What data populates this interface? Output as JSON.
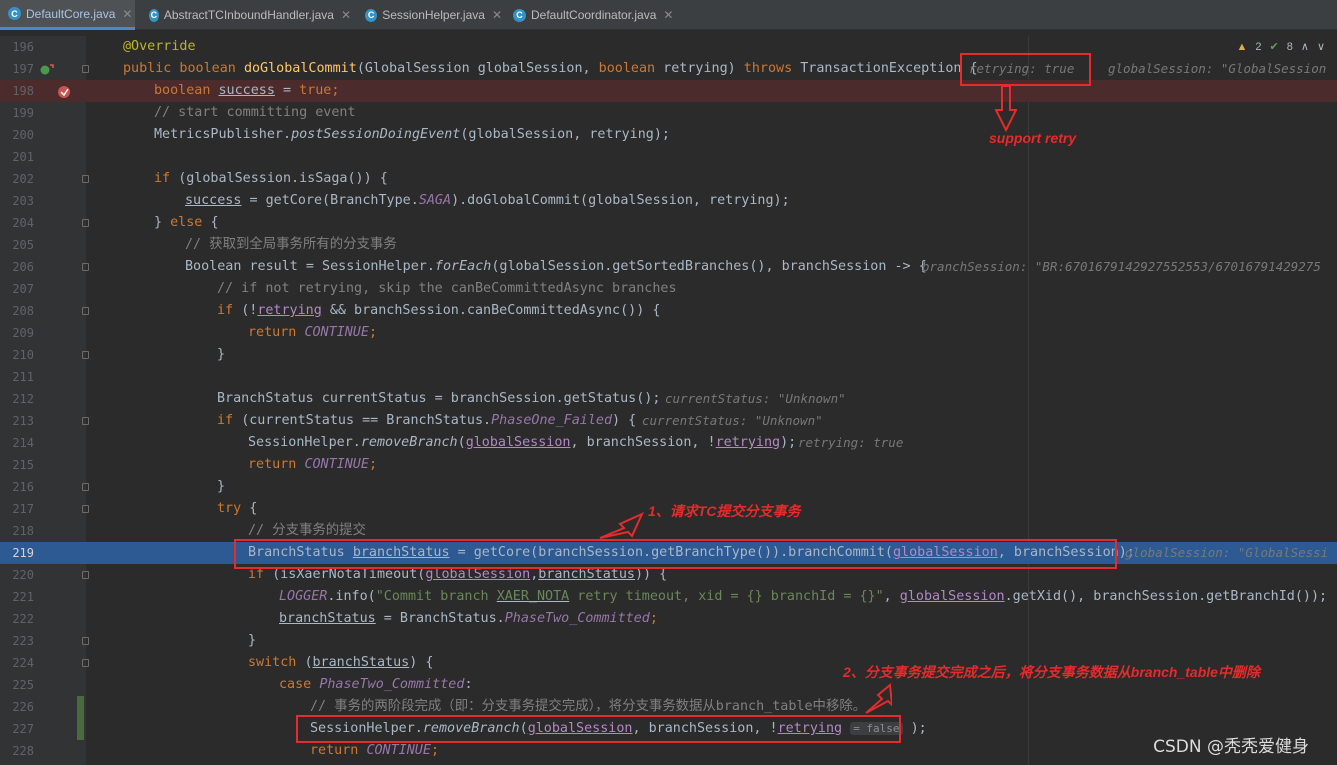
{
  "tabs": [
    {
      "label": "DefaultCore.java",
      "active": true
    },
    {
      "label": "AbstractTCInboundHandler.java",
      "active": false
    },
    {
      "label": "SessionHelper.java",
      "active": false
    },
    {
      "label": "DefaultCoordinator.java",
      "active": false
    }
  ],
  "tab_icon": "java-class-icon",
  "inspection": {
    "warnings": "2",
    "weak_warnings": "8",
    "up": "∧",
    "down": "∨"
  },
  "lines": [
    "196",
    "197",
    "198",
    "199",
    "200",
    "201",
    "202",
    "203",
    "204",
    "205",
    "206",
    "207",
    "208",
    "209",
    "210",
    "211",
    "212",
    "213",
    "214",
    "215",
    "216",
    "217",
    "218",
    "219",
    "220",
    "221",
    "222",
    "223",
    "224",
    "225",
    "226",
    "227",
    "228"
  ],
  "code": {
    "l196": "@Override",
    "l197_kw": "public boolean ",
    "l197_fn": "doGlobalCommit",
    "l197_a": "(GlobalSession globalSession, ",
    "l197_kw2": "boolean ",
    "l197_b": "retrying) ",
    "l197_kw3": "throws ",
    "l197_c": "TransactionException {",
    "l197_hint1": "retrying: true",
    "l197_hint2": "globalSession: \"GlobalSession",
    "l198_kw": "boolean ",
    "l198_var": "success",
    "l198_rest": " = ",
    "l198_kw2": "true",
    "l198_end": ";",
    "l199": "// start committing event",
    "l200_a": "MetricsPublisher.",
    "l200_fn": "postSessionDoingEvent",
    "l200_b": "(globalSession, retrying);",
    "l202_kw": "if ",
    "l202_a": "(globalSession.isSaga()) {",
    "l203_var": "success",
    "l203_a": " = getCore(BranchType.",
    "l203_cs": "SAGA",
    "l203_b": ").doGlobalCommit(globalSession, retrying);",
    "l204_a": "} ",
    "l204_kw": "else ",
    "l204_b": "{",
    "l205": "// 获取到全局事务所有的分支事务",
    "l206_a": "Boolean result = SessionHelper.",
    "l206_fn": "forEach",
    "l206_b": "(globalSession.getSortedBranches(), branchSession -> {",
    "l206_hint": "branchSession: \"BR:6701679142927552553/67016791429275",
    "l207": "// if not retrying, skip the canBeCommittedAsync branches",
    "l208_kw": "if ",
    "l208_a": "(!",
    "l208_var": "retrying",
    "l208_b": " && branchSession.canBeCommittedAsync()) {",
    "l209_kw": "return ",
    "l209_cs": "CONTINUE",
    "l209_end": ";",
    "l210": "}",
    "l212_a": "BranchStatus currentStatus = branchSession.getStatus();",
    "l212_hint": "currentStatus: \"Unknown\"",
    "l213_kw": "if ",
    "l213_a": "(currentStatus == BranchStatus.",
    "l213_cs": "PhaseOne_Failed",
    "l213_b": ") {",
    "l213_hint": "currentStatus: \"Unknown\"",
    "l214_a": "SessionHelper.",
    "l214_fn": "removeBranch",
    "l214_b": "(",
    "l214_pl": "globalSession",
    "l214_c": ", branchSession, !",
    "l214_pl2": "retrying",
    "l214_d": ");",
    "l214_hint": "retrying: true",
    "l215_kw": "return ",
    "l215_cs": "CONTINUE",
    "l215_end": ";",
    "l216": "}",
    "l217_kw": "try ",
    "l217_a": "{",
    "l218": "// 分支事务的提交",
    "l219_a": "BranchStatus ",
    "l219_var": "branchStatus",
    "l219_b": " = getCore(branchSession.getBranchType()).branchCommit(",
    "l219_pl": "globalSession",
    "l219_c": ", branchSession);",
    "l219_hint": "globalSession: \"GlobalSessi",
    "l220_kw": "if ",
    "l220_a": "(isXaerNotaTimeout(",
    "l220_pl": "globalSession",
    "l220_b": ",",
    "l220_var": "branchStatus",
    "l220_c": ")) {",
    "l221_cs": "LOGGER",
    "l221_a": ".info(",
    "l221_st": "\"Commit branch ",
    "l221_st2": "XAER_NOTA",
    "l221_st3": " retry timeout, xid = {} branchId = {}\"",
    "l221_b": ", ",
    "l221_pl": "globalSession",
    "l221_c": ".getXid(), branchSession.getBranchId());",
    "l222_var": "branchStatus",
    "l222_a": " = BranchStatus.",
    "l222_cs": "PhaseTwo_Committed",
    "l222_end": ";",
    "l223": "}",
    "l224_kw": "switch ",
    "l224_a": "(",
    "l224_var": "branchStatus",
    "l224_b": ") {",
    "l225_kw": "case ",
    "l225_cs": "PhaseTwo_Committed",
    "l225_a": ":",
    "l226": "// 事务的两阶段完成（即：分支事务提交完成），将分支事务数据从branch_table中移除。",
    "l227_a": "SessionHelper.",
    "l227_fn": "removeBranch",
    "l227_b": "(",
    "l227_pl": "globalSession",
    "l227_c": ", branchSession, !",
    "l227_pl2": "retrying",
    "l227_inlay": "= false",
    "l227_d": " );",
    "l228_kw": "return ",
    "l228_cs": "CONTINUE",
    "l228_end": ";"
  },
  "annotations": {
    "support_retry": "support retry",
    "step1": "1、请求TC提交分支事务",
    "step2": "2、分支事务提交完成之后，将分支事务数据从branch_table中删除"
  },
  "watermark": "CSDN @秃秃爱健身",
  "colors": {
    "accent": "#e52b2b",
    "current_line": "#2d5a92",
    "keyword": "#cc7832"
  }
}
